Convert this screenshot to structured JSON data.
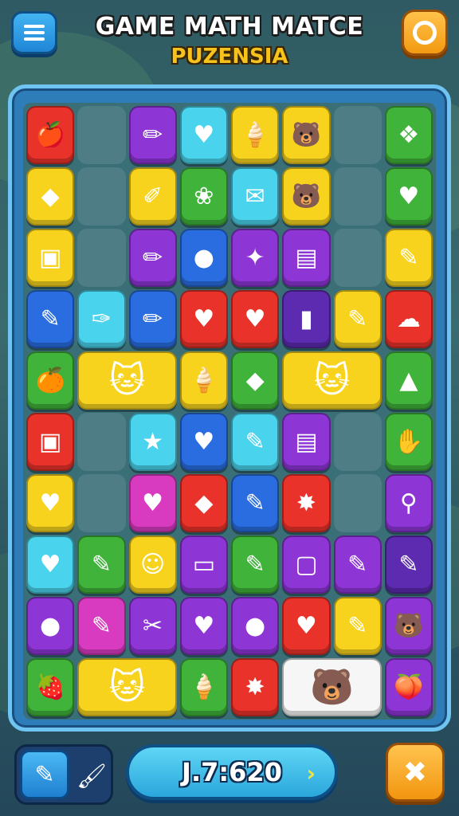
{
  "header": {
    "title": "GAME MATH MATCE",
    "subtitle": "PUZENSIA",
    "menu_icon": "hamburger-menu-icon",
    "settings_icon": "settings-icon"
  },
  "footer": {
    "score": "J.7:620",
    "score_arrow": "›",
    "tool_pencil_icon": "✎",
    "tool_brush_icon": "🖌",
    "booster_icon": "✖"
  },
  "board": {
    "rows": 10,
    "cols": 7,
    "tiles": [
      {
        "r": 0,
        "c": 0,
        "w": 1,
        "h": 1,
        "color": "red",
        "glyph": "🍎",
        "name": "apple"
      },
      {
        "r": 0,
        "c": 1,
        "w": 1,
        "h": 1,
        "color": "empty",
        "glyph": "",
        "name": "empty"
      },
      {
        "r": 0,
        "c": 2,
        "w": 1,
        "h": 1,
        "color": "purple",
        "glyph": "✏",
        "name": "pencil"
      },
      {
        "r": 0,
        "c": 3,
        "w": 1,
        "h": 1,
        "color": "cyan",
        "glyph": "♥",
        "name": "heart"
      },
      {
        "r": 0,
        "c": 4,
        "w": 1,
        "h": 1,
        "color": "yellow",
        "glyph": "🍦",
        "name": "ice-cream"
      },
      {
        "r": 0,
        "c": 5,
        "w": 1,
        "h": 1,
        "color": "yellow",
        "glyph": "🐻",
        "name": "bear"
      },
      {
        "r": 0,
        "c": 6,
        "w": 1,
        "h": 1,
        "color": "empty",
        "glyph": "",
        "name": "empty"
      },
      {
        "r": 0,
        "c": 7,
        "w": 1,
        "h": 1,
        "color": "green",
        "glyph": "❖",
        "name": "leaf"
      },
      {
        "r": 1,
        "c": 0,
        "w": 1,
        "h": 1,
        "color": "yellow",
        "glyph": "◆",
        "name": "gem"
      },
      {
        "r": 1,
        "c": 1,
        "w": 1,
        "h": 1,
        "color": "empty",
        "glyph": "",
        "name": "empty"
      },
      {
        "r": 1,
        "c": 2,
        "w": 1,
        "h": 1,
        "color": "yellow",
        "glyph": "✐",
        "name": "crayon"
      },
      {
        "r": 1,
        "c": 3,
        "w": 1,
        "h": 1,
        "color": "green",
        "glyph": "❀",
        "name": "flower"
      },
      {
        "r": 1,
        "c": 4,
        "w": 1,
        "h": 1,
        "color": "cyan",
        "glyph": "✉",
        "name": "envelope"
      },
      {
        "r": 1,
        "c": 5,
        "w": 1,
        "h": 1,
        "color": "yellow",
        "glyph": "🐻",
        "name": "bear"
      },
      {
        "r": 1,
        "c": 6,
        "w": 1,
        "h": 1,
        "color": "empty",
        "glyph": "",
        "name": "empty"
      },
      {
        "r": 1,
        "c": 7,
        "w": 1,
        "h": 1,
        "color": "green",
        "glyph": "♥",
        "name": "heart"
      },
      {
        "r": 2,
        "c": 0,
        "w": 1,
        "h": 1,
        "color": "yellow",
        "glyph": "▣",
        "name": "robot"
      },
      {
        "r": 2,
        "c": 1,
        "w": 1,
        "h": 1,
        "color": "empty",
        "glyph": "",
        "name": "empty"
      },
      {
        "r": 2,
        "c": 2,
        "w": 1,
        "h": 1,
        "color": "purple",
        "glyph": "✏",
        "name": "pencil"
      },
      {
        "r": 2,
        "c": 3,
        "w": 1,
        "h": 1,
        "color": "blue",
        "glyph": "●",
        "name": "drop"
      },
      {
        "r": 2,
        "c": 4,
        "w": 1,
        "h": 1,
        "color": "purple",
        "glyph": "✦",
        "name": "star"
      },
      {
        "r": 2,
        "c": 5,
        "w": 1,
        "h": 1,
        "color": "purple",
        "glyph": "▤",
        "name": "box"
      },
      {
        "r": 2,
        "c": 6,
        "w": 1,
        "h": 1,
        "color": "empty",
        "glyph": "",
        "name": "empty"
      },
      {
        "r": 2,
        "c": 7,
        "w": 1,
        "h": 1,
        "color": "yellow",
        "glyph": "✎",
        "name": "pen"
      },
      {
        "r": 3,
        "c": 0,
        "w": 1,
        "h": 1,
        "color": "blue",
        "glyph": "✎",
        "name": "pen"
      },
      {
        "r": 3,
        "c": 1,
        "w": 1,
        "h": 1,
        "color": "cyan",
        "glyph": "✑",
        "name": "brush"
      },
      {
        "r": 3,
        "c": 2,
        "w": 1,
        "h": 1,
        "color": "blue",
        "glyph": "✏",
        "name": "pencil"
      },
      {
        "r": 3,
        "c": 3,
        "w": 1,
        "h": 1,
        "color": "red",
        "glyph": "♥",
        "name": "heart"
      },
      {
        "r": 3,
        "c": 4,
        "w": 1,
        "h": 1,
        "color": "red",
        "glyph": "♥",
        "name": "heart"
      },
      {
        "r": 3,
        "c": 5,
        "w": 1,
        "h": 1,
        "color": "darkpurple",
        "glyph": "▮",
        "name": "bottle"
      },
      {
        "r": 3,
        "c": 6,
        "w": 1,
        "h": 1,
        "color": "yellow",
        "glyph": "✎",
        "name": "pen"
      },
      {
        "r": 3,
        "c": 7,
        "w": 1,
        "h": 1,
        "color": "red",
        "glyph": "☁",
        "name": "bird"
      },
      {
        "r": 4,
        "c": 0,
        "w": 1,
        "h": 1,
        "color": "green",
        "glyph": "🍊",
        "name": "orange"
      },
      {
        "r": 4,
        "c": 1,
        "w": 2,
        "h": 1,
        "color": "yellow",
        "glyph": "🐱",
        "name": "cat"
      },
      {
        "r": 4,
        "c": 3,
        "w": 1,
        "h": 1,
        "color": "yellow",
        "glyph": "🍦",
        "name": "ice-cream"
      },
      {
        "r": 4,
        "c": 4,
        "w": 1,
        "h": 1,
        "color": "green",
        "glyph": "◆",
        "name": "crystal"
      },
      {
        "r": 4,
        "c": 5,
        "w": 2,
        "h": 1,
        "color": "yellow",
        "glyph": "🐱",
        "name": "cat"
      },
      {
        "r": 4,
        "c": 7,
        "w": 1,
        "h": 1,
        "color": "green",
        "glyph": "▲",
        "name": "carrot"
      },
      {
        "r": 5,
        "c": 0,
        "w": 1,
        "h": 1,
        "color": "red",
        "glyph": "▣",
        "name": "phone"
      },
      {
        "r": 5,
        "c": 1,
        "w": 1,
        "h": 1,
        "color": "empty",
        "glyph": "",
        "name": "empty"
      },
      {
        "r": 5,
        "c": 2,
        "w": 1,
        "h": 1,
        "color": "cyan",
        "glyph": "★",
        "name": "star"
      },
      {
        "r": 5,
        "c": 3,
        "w": 1,
        "h": 1,
        "color": "blue",
        "glyph": "♥",
        "name": "heart"
      },
      {
        "r": 5,
        "c": 4,
        "w": 1,
        "h": 1,
        "color": "cyan",
        "glyph": "✎",
        "name": "pen"
      },
      {
        "r": 5,
        "c": 5,
        "w": 1,
        "h": 1,
        "color": "purple",
        "glyph": "▤",
        "name": "box"
      },
      {
        "r": 5,
        "c": 6,
        "w": 1,
        "h": 1,
        "color": "empty",
        "glyph": "",
        "name": "empty"
      },
      {
        "r": 5,
        "c": 7,
        "w": 1,
        "h": 1,
        "color": "green",
        "glyph": "✋",
        "name": "glove"
      },
      {
        "r": 6,
        "c": 0,
        "w": 1,
        "h": 1,
        "color": "yellow",
        "glyph": "♥",
        "name": "heart"
      },
      {
        "r": 6,
        "c": 1,
        "w": 1,
        "h": 1,
        "color": "empty",
        "glyph": "",
        "name": "empty"
      },
      {
        "r": 6,
        "c": 2,
        "w": 1,
        "h": 1,
        "color": "magenta",
        "glyph": "♥",
        "name": "heart"
      },
      {
        "r": 6,
        "c": 3,
        "w": 1,
        "h": 1,
        "color": "red",
        "glyph": "◆",
        "name": "gem"
      },
      {
        "r": 6,
        "c": 4,
        "w": 1,
        "h": 1,
        "color": "blue",
        "glyph": "✎",
        "name": "pen"
      },
      {
        "r": 6,
        "c": 5,
        "w": 1,
        "h": 1,
        "color": "red",
        "glyph": "✸",
        "name": "flower"
      },
      {
        "r": 6,
        "c": 6,
        "w": 1,
        "h": 1,
        "color": "empty",
        "glyph": "",
        "name": "empty"
      },
      {
        "r": 6,
        "c": 7,
        "w": 1,
        "h": 1,
        "color": "purple",
        "glyph": "⚲",
        "name": "magnifier"
      },
      {
        "r": 7,
        "c": 0,
        "w": 1,
        "h": 1,
        "color": "cyan",
        "glyph": "♥",
        "name": "heart"
      },
      {
        "r": 7,
        "c": 1,
        "w": 1,
        "h": 1,
        "color": "green",
        "glyph": "✎",
        "name": "pen"
      },
      {
        "r": 7,
        "c": 2,
        "w": 1,
        "h": 1,
        "color": "yellow",
        "glyph": "☺",
        "name": "face"
      },
      {
        "r": 7,
        "c": 3,
        "w": 1,
        "h": 1,
        "color": "purple",
        "glyph": "▭",
        "name": "card"
      },
      {
        "r": 7,
        "c": 4,
        "w": 1,
        "h": 1,
        "color": "green",
        "glyph": "✎",
        "name": "brush"
      },
      {
        "r": 7,
        "c": 5,
        "w": 1,
        "h": 1,
        "color": "purple",
        "glyph": "▢",
        "name": "tablet"
      },
      {
        "r": 7,
        "c": 6,
        "w": 1,
        "h": 1,
        "color": "purple",
        "glyph": "✎",
        "name": "pen"
      },
      {
        "r": 7,
        "c": 7,
        "w": 1,
        "h": 1,
        "color": "darkpurple",
        "glyph": "✎",
        "name": "crayon"
      },
      {
        "r": 8,
        "c": 0,
        "w": 1,
        "h": 1,
        "color": "purple",
        "glyph": "●",
        "name": "apple"
      },
      {
        "r": 8,
        "c": 1,
        "w": 1,
        "h": 1,
        "color": "magenta",
        "glyph": "✎",
        "name": "pen"
      },
      {
        "r": 8,
        "c": 2,
        "w": 1,
        "h": 1,
        "color": "purple",
        "glyph": "✂",
        "name": "cutter"
      },
      {
        "r": 8,
        "c": 3,
        "w": 1,
        "h": 1,
        "color": "purple",
        "glyph": "♥",
        "name": "heart"
      },
      {
        "r": 8,
        "c": 4,
        "w": 1,
        "h": 1,
        "color": "purple",
        "glyph": "●",
        "name": "orb"
      },
      {
        "r": 8,
        "c": 5,
        "w": 1,
        "h": 1,
        "color": "red",
        "glyph": "♥",
        "name": "heart"
      },
      {
        "r": 8,
        "c": 6,
        "w": 1,
        "h": 1,
        "color": "yellow",
        "glyph": "✎",
        "name": "pen"
      },
      {
        "r": 8,
        "c": 7,
        "w": 1,
        "h": 1,
        "color": "purple",
        "glyph": "🐻",
        "name": "bear"
      },
      {
        "r": 9,
        "c": 0,
        "w": 1,
        "h": 1,
        "color": "green",
        "glyph": "🍓",
        "name": "berry"
      },
      {
        "r": 9,
        "c": 1,
        "w": 2,
        "h": 1,
        "color": "yellow",
        "glyph": "🐱",
        "name": "cat"
      },
      {
        "r": 9,
        "c": 3,
        "w": 1,
        "h": 1,
        "color": "green",
        "glyph": "🍦",
        "name": "ice-cream"
      },
      {
        "r": 9,
        "c": 4,
        "w": 1,
        "h": 1,
        "color": "red",
        "glyph": "✸",
        "name": "burst"
      },
      {
        "r": 9,
        "c": 5,
        "w": 2,
        "h": 1,
        "color": "white",
        "glyph": "🐻",
        "name": "bear"
      },
      {
        "r": 9,
        "c": 7,
        "w": 1,
        "h": 1,
        "color": "purple",
        "glyph": "🍑",
        "name": "peach"
      }
    ]
  },
  "colors": {
    "red": "#e8322a",
    "green": "#3fb33a",
    "yellow": "#f7d31e",
    "purple": "#8e35d6",
    "cyan": "#49d3ec",
    "blue": "#2a6de0",
    "white": "#f6f6f6",
    "darkpurple": "#5c2bb0",
    "magenta": "#d83ac0"
  }
}
